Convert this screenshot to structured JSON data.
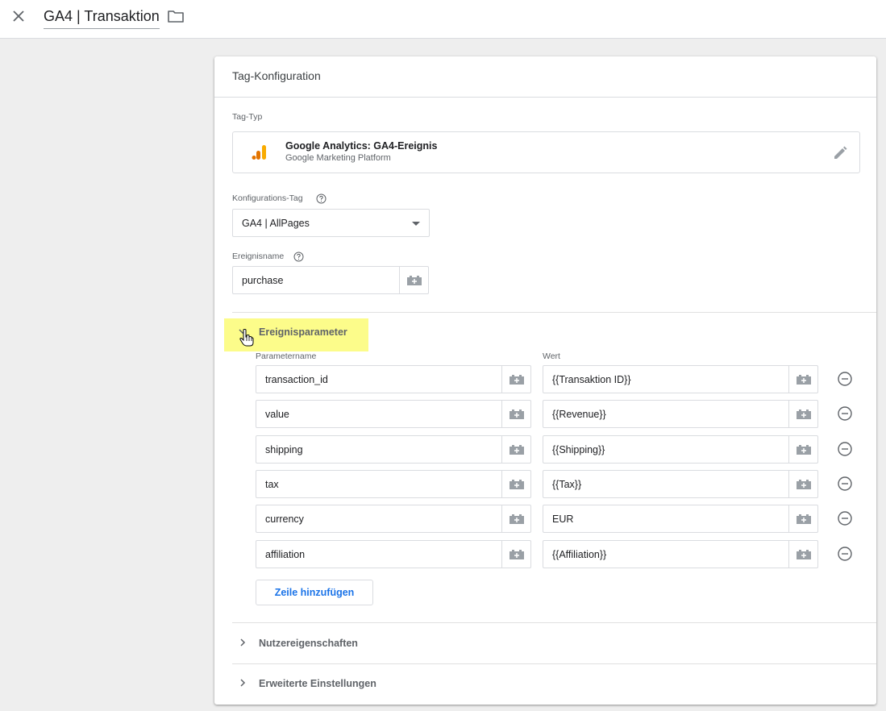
{
  "header": {
    "title": "GA4 | Transaktion"
  },
  "card": {
    "title": "Tag-Konfiguration",
    "tag_type": {
      "label": "Tag-Typ",
      "name": "Google Analytics: GA4-Ereignis",
      "subtitle": "Google Marketing Platform"
    },
    "config_tag": {
      "label": "Konfigurations-Tag",
      "value": "GA4 | AllPages"
    },
    "event_name": {
      "label": "Ereignisname",
      "value": "purchase"
    },
    "event_params": {
      "section_label": "Ereignisparameter",
      "col_name": "Parametername",
      "col_value": "Wert",
      "rows": [
        {
          "name": "transaction_id",
          "value": "{{Transaktion ID}}"
        },
        {
          "name": "value",
          "value": "{{Revenue}}"
        },
        {
          "name": "shipping",
          "value": "{{Shipping}}"
        },
        {
          "name": "tax",
          "value": "{{Tax}}"
        },
        {
          "name": "currency",
          "value": "EUR"
        },
        {
          "name": "affiliation",
          "value": "{{Affiliation}}"
        }
      ],
      "add_row_label": "Zeile hinzufügen"
    },
    "user_properties_label": "Nutzereigenschaften",
    "advanced_settings_label": "Erweiterte Einstellungen"
  },
  "icons": {
    "close": "close-icon",
    "folder": "folder-icon",
    "analytics": "analytics-bars-icon",
    "edit": "pencil-icon",
    "help": "help-circle-icon",
    "variable": "variable-brick-icon",
    "remove": "minus-circle-icon",
    "chevron_down": "chevron-down-icon",
    "chevron_right": "chevron-right-icon",
    "cursor": "hand-pointer-icon"
  },
  "colors": {
    "accent": "#1a73e8",
    "highlight": "#fcfc8a",
    "ga_orange": "#f9ab00",
    "ga_dark_orange": "#e37400"
  }
}
